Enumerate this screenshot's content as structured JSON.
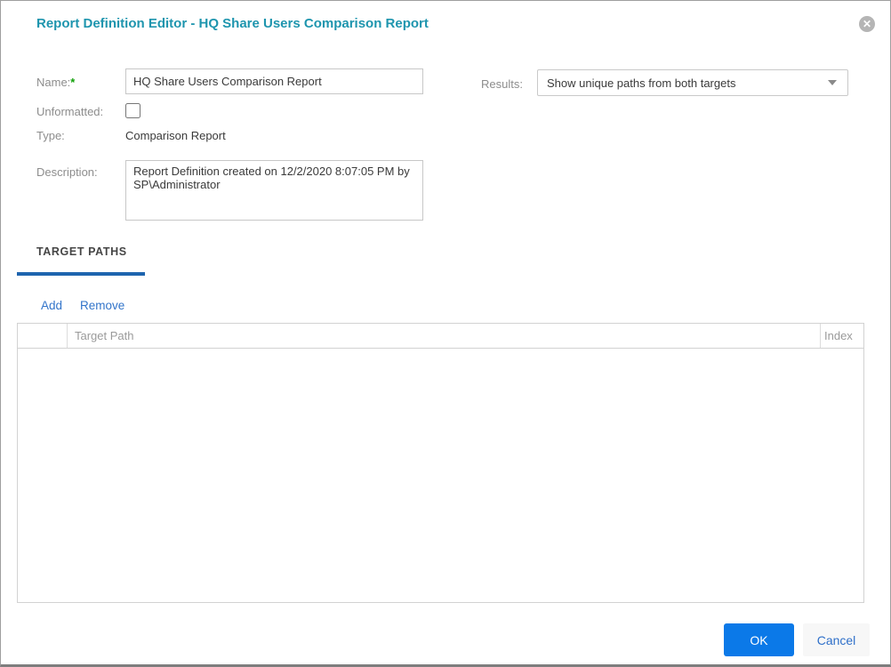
{
  "dialog": {
    "title": "Report Definition Editor - HQ Share Users Comparison Report",
    "close_glyph": "✕"
  },
  "form": {
    "name_label": "Name:",
    "required_marker": "*",
    "name_value": "HQ Share Users Comparison Report",
    "results_label": "Results:",
    "results_value": "Show unique paths from both targets",
    "unformatted_label": "Unformatted:",
    "unformatted_checked": false,
    "type_label": "Type:",
    "type_value": "Comparison Report",
    "description_label": "Description:",
    "description_value": "Report Definition created on 12/2/2020 8:07:05 PM by SP\\Administrator"
  },
  "tabs": {
    "target_paths_label": "TARGET PATHS"
  },
  "toolbar": {
    "add_label": "Add",
    "remove_label": "Remove"
  },
  "table": {
    "columns": [
      "",
      "Target Path",
      "Index"
    ],
    "rows": []
  },
  "footer": {
    "ok_label": "OK",
    "cancel_label": "Cancel"
  },
  "colors": {
    "title_teal": "#1e95ae",
    "accent_blue": "#0b79e8",
    "link_blue": "#3274ca",
    "tab_underline_blue": "#1e64ae",
    "label_gray": "#8d8d8d",
    "required_green": "#12a10a"
  }
}
